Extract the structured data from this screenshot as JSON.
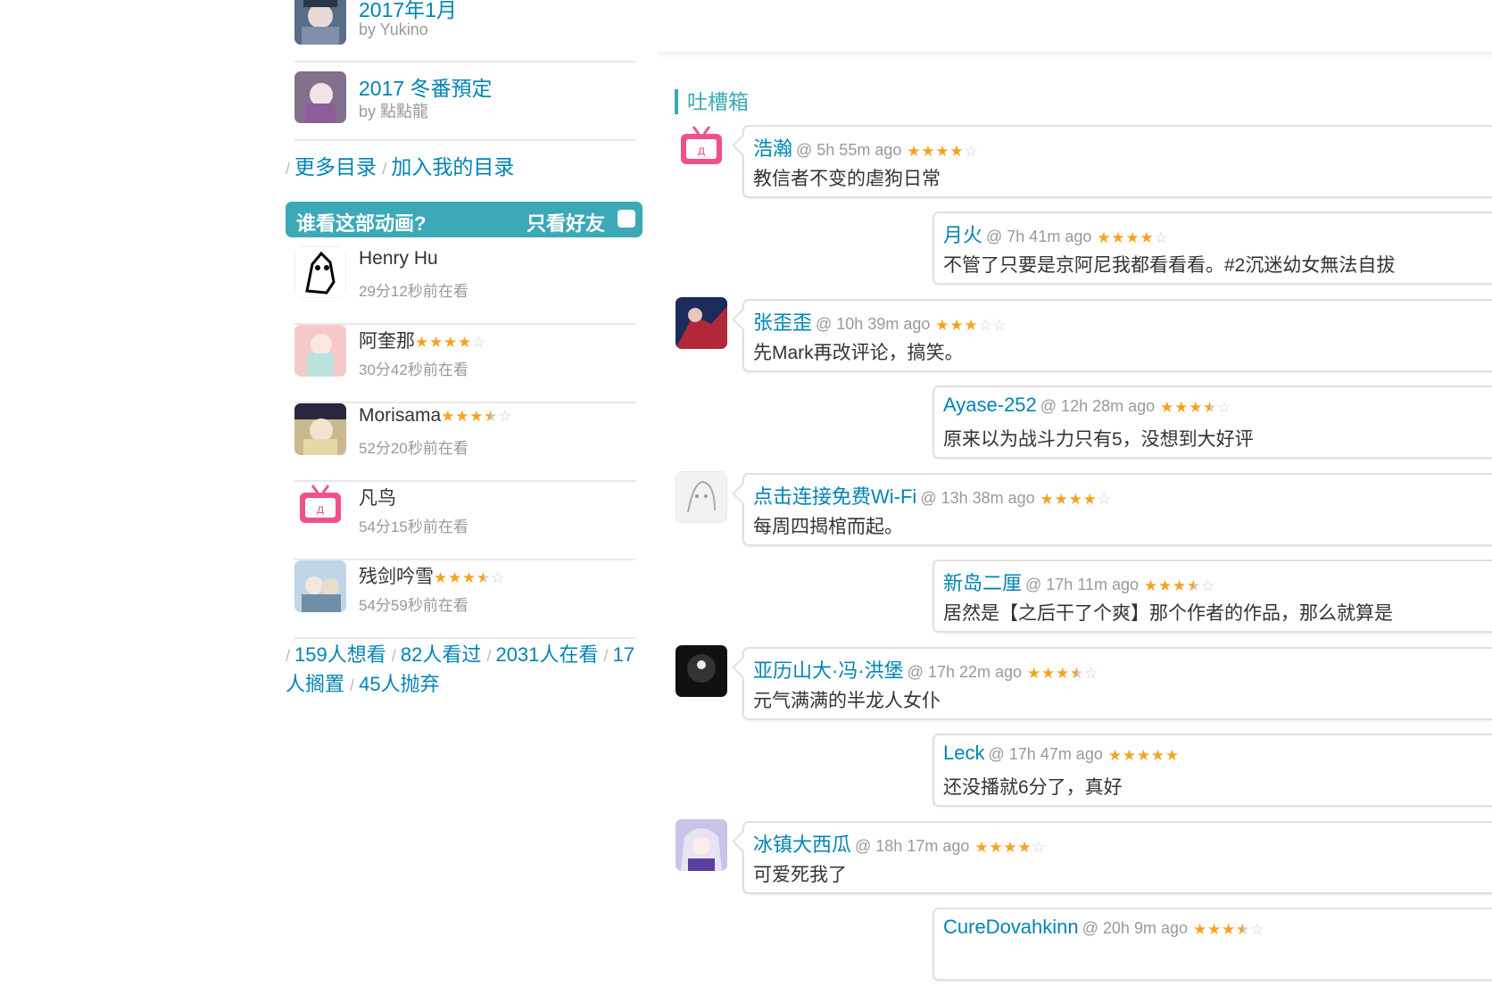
{
  "index_items": [
    {
      "title": "2017年1月",
      "by": "by Yukino"
    },
    {
      "title": "2017 冬番預定",
      "by": "by 點點龍"
    }
  ],
  "index_links": {
    "more": "更多目录",
    "add": "加入我的目录"
  },
  "who_box": {
    "title": "谁看这部动画?",
    "friends_only": "只看好友"
  },
  "viewers": [
    {
      "name": "Henry Hu",
      "time": "29分12秒前在看",
      "rating": 0
    },
    {
      "name": "阿奎那",
      "time": "30分42秒前在看",
      "rating": 4
    },
    {
      "name": "Morisama",
      "time": "52分20秒前在看",
      "rating": 3.5
    },
    {
      "name": "凡鸟",
      "time": "54分15秒前在看",
      "rating": 0
    },
    {
      "name": "残剑吟雪",
      "time": "54分59秒前在看",
      "rating": 3.5
    }
  ],
  "counts": {
    "wish": "159人想看",
    "done": "82人看过",
    "doing": "2031人在看",
    "on_hold": "17人搁置",
    "dropped": "45人抛弃"
  },
  "comment_box": {
    "title": "吐槽箱"
  },
  "comments": [
    {
      "user": "浩瀚",
      "meta": "@ 5h 55m ago",
      "rating": 4,
      "text": "教信者不变的虐狗日常"
    },
    {
      "user": "月火",
      "meta": "@ 7h 41m ago",
      "rating": 4,
      "text": "不管了只要是京阿尼我都看看看。#2沉迷幼女無法自拔"
    },
    {
      "user": "张歪歪",
      "meta": "@ 10h 39m ago",
      "rating": 3,
      "text": "先Mark再改评论，搞笑。"
    },
    {
      "user": "Ayase-252",
      "meta": "@ 12h 28m ago",
      "rating": 3.5,
      "text": "原来以为战斗力只有5，没想到大好评"
    },
    {
      "user": "点击连接免费Wi-Fi",
      "meta": "@ 13h 38m ago",
      "rating": 4,
      "text": "每周四揭棺而起。"
    },
    {
      "user": "新岛二厘",
      "meta": "@ 17h 11m ago",
      "rating": 3.5,
      "text": "居然是【之后干了个爽】那个作者的作品，那么就算是"
    },
    {
      "user": "亚历山大·冯·洪堡",
      "meta": "@ 17h 22m ago",
      "rating": 3.5,
      "text": "元气满满的半龙人女仆"
    },
    {
      "user": "Leck",
      "meta": "@ 17h 47m ago",
      "rating": 5,
      "text": "还没播就6分了，真好"
    },
    {
      "user": "冰镇大西瓜",
      "meta": "@ 18h 17m ago",
      "rating": 4,
      "text": "可爱死我了"
    },
    {
      "user": "CureDovahkinn",
      "meta": "@ 20h 9m ago",
      "rating": 3.5,
      "text": ""
    }
  ],
  "colors": {
    "link": "#0084B4",
    "accent": "#3BA9B6",
    "star": "#F6A21E"
  }
}
